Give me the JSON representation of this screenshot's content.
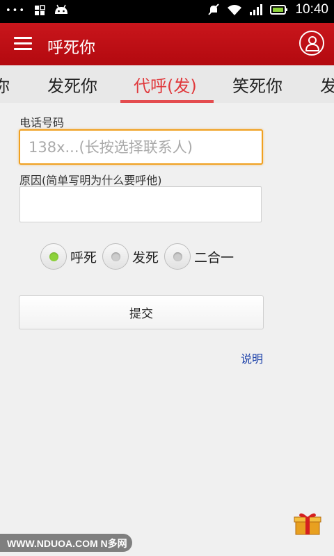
{
  "statusbar": {
    "time": "10:40"
  },
  "appbar": {
    "title": "呼死你"
  },
  "tabs": [
    {
      "label": "你"
    },
    {
      "label": "发死你"
    },
    {
      "label": "代呼(发)"
    },
    {
      "label": "笑死你"
    },
    {
      "label": "发"
    }
  ],
  "form": {
    "phone_label": "电话号码",
    "phone_placeholder": "138x...(长按选择联系人)",
    "reason_label": "原因(简单写明为什么要呼他)",
    "reason_value": "",
    "options": [
      {
        "label": "呼死"
      },
      {
        "label": "发死"
      },
      {
        "label": "二合一"
      }
    ],
    "selected_option": "呼死",
    "submit_label": "提交",
    "help_label": "说明"
  },
  "watermark": {
    "text": "WWW.NDUOA.COM N多网"
  },
  "colors": {
    "appbar": "#c9161c",
    "active_tab": "#e0393c",
    "accent": "#f0a020",
    "link": "#1a3fa8",
    "radio_checked": "#8cd23a"
  }
}
